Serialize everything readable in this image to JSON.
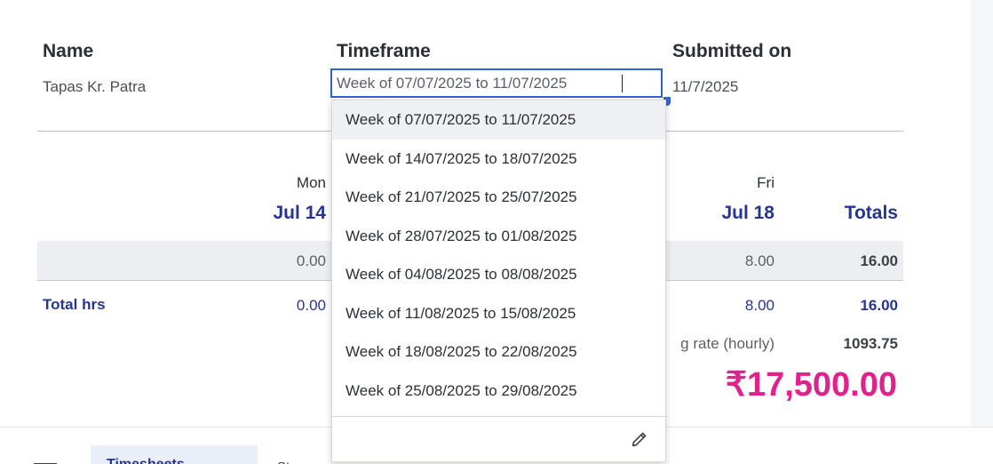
{
  "header": {
    "name_label": "Name",
    "name_value": "Tapas Kr. Patra",
    "timeframe_label": "Timeframe",
    "timeframe_value": "Week of 07/07/2025 to 11/07/2025",
    "submitted_label": "Submitted on",
    "submitted_value": "11/7/2025"
  },
  "days": {
    "mon_name": "Mon",
    "mon_date": "Jul 14",
    "fri_name": "Fri",
    "fri_date": "Jul 18",
    "totals_label": "Totals"
  },
  "rows": {
    "entry": {
      "mon": "0.00",
      "fri": "8.00",
      "total": "16.00"
    },
    "total_hrs": {
      "label": "Total hrs",
      "mon": "0.00",
      "fri": "8.00",
      "total": "16.00"
    }
  },
  "billing": {
    "rate_label_partial": "g rate (hourly)",
    "rate_value": "1093.75",
    "amount": "₹17,500.00"
  },
  "dropdown": {
    "options": [
      "Week of 07/07/2025 to 11/07/2025",
      "Week of 14/07/2025 to 18/07/2025",
      "Week of 21/07/2025 to 25/07/2025",
      "Week of 28/07/2025 to 01/08/2025",
      "Week of 04/08/2025 to 08/08/2025",
      "Week of 11/08/2025 to 15/08/2025",
      "Week of 18/08/2025 to 22/08/2025",
      "Week of 25/08/2025 to 29/08/2025"
    ],
    "selected_index": 0,
    "edit_icon": "pencil-icon"
  },
  "bottom_tabs": {
    "active_label": "Timesheets",
    "other_label": "St"
  },
  "colors": {
    "accent_blue": "#26358f",
    "focus_blue": "#2f62d6",
    "amount_pink": "#e0228c"
  }
}
